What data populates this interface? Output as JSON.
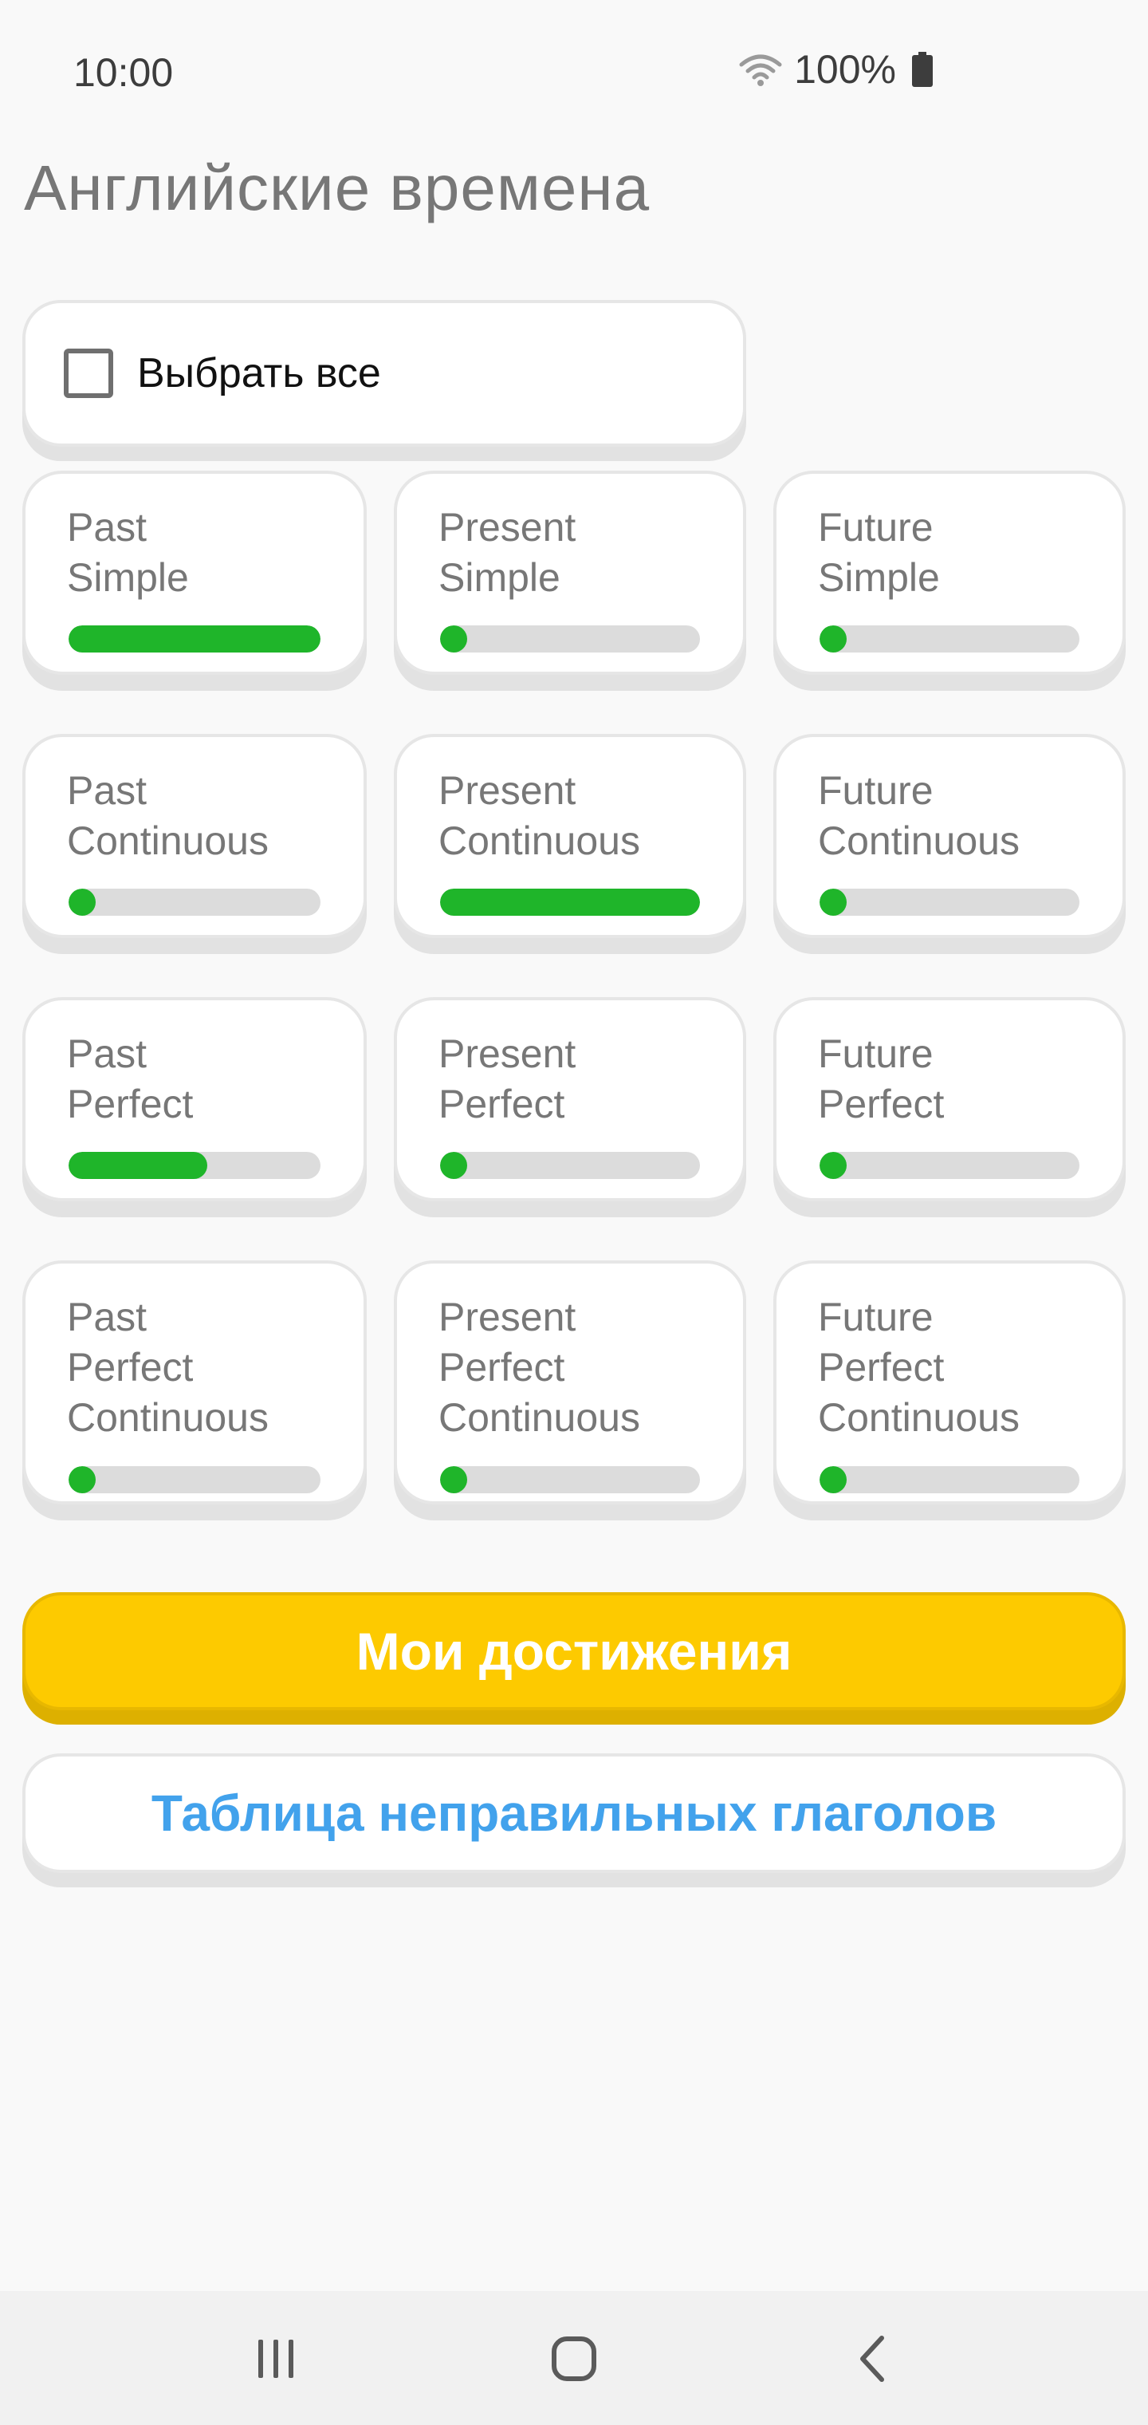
{
  "status_bar": {
    "time": "10:00",
    "battery_text": "100%"
  },
  "page": {
    "title": "Английские времена"
  },
  "select_all": {
    "label": "Выбрать все",
    "checked": false
  },
  "tenses": [
    {
      "label": "Past\nSimple",
      "progress": 1.0
    },
    {
      "label": "Present\nSimple",
      "progress": 0.0
    },
    {
      "label": "Future\nSimple",
      "progress": 0.0
    },
    {
      "label": "Past\nContinuous",
      "progress": 0.0
    },
    {
      "label": "Present\nContinuous",
      "progress": 1.0
    },
    {
      "label": "Future\nContinuous",
      "progress": 0.0
    },
    {
      "label": "Past\nPerfect",
      "progress": 0.55
    },
    {
      "label": "Present\nPerfect",
      "progress": 0.0
    },
    {
      "label": "Future\nPerfect",
      "progress": 0.0
    },
    {
      "label": "Past\nPerfect\nContinuous",
      "progress": 0.0
    },
    {
      "label": "Present\nPerfect\nContinuous",
      "progress": 0.0
    },
    {
      "label": "Future\nPerfect\nContinuous",
      "progress": 0.0
    }
  ],
  "buttons": {
    "achievements": "Мои достижения",
    "irregular_verbs": "Таблица неправильных глаголов"
  },
  "colors": {
    "progress_fill": "#1fb52a",
    "achievements_bg": "#fdca00",
    "irregular_text": "#42a2ec"
  },
  "icons": {
    "wifi": "wifi-icon",
    "battery": "battery-icon",
    "recent": "recent-apps-icon",
    "home": "home-icon",
    "back": "back-icon"
  }
}
